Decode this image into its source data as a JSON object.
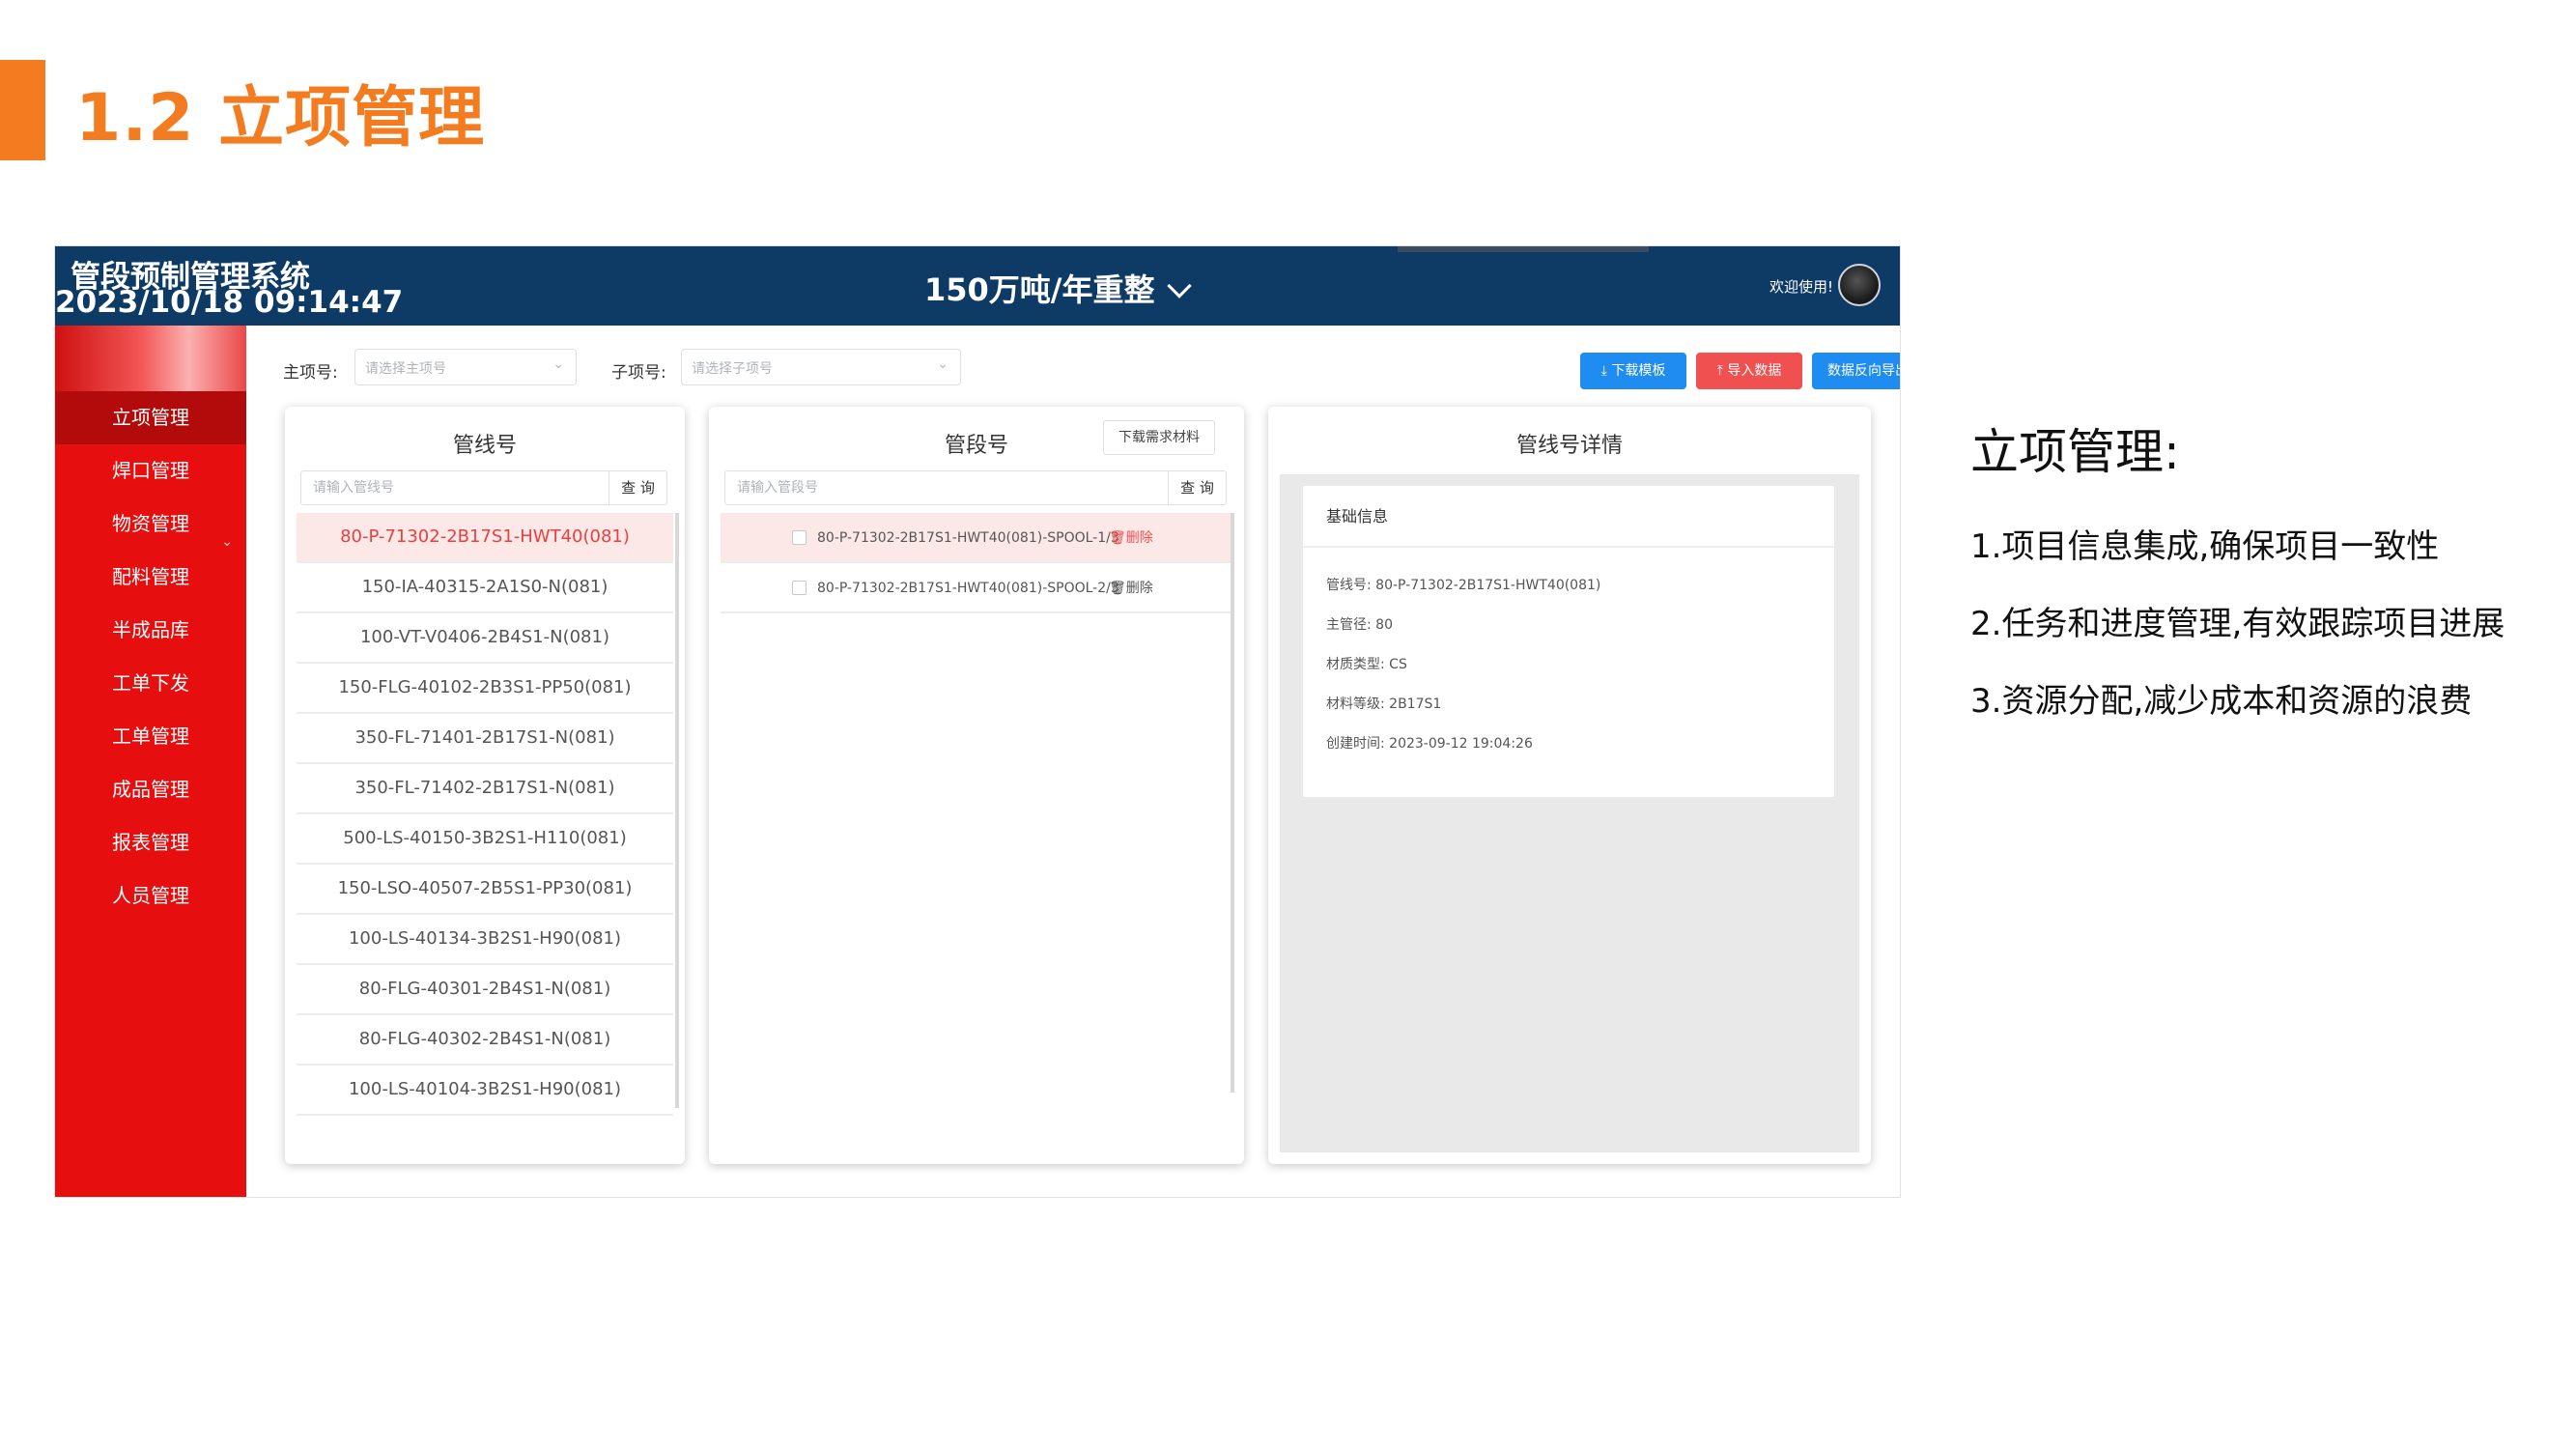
{
  "slide": {
    "title": "1.2 立项管理",
    "notes_heading": "立项管理:",
    "notes": [
      "1.项目信息集成,确保项目一致性",
      "2.任务和进度管理,有效跟踪项目进展",
      "3.资源分配,减少成本和资源的浪费"
    ]
  },
  "app": {
    "system_name": "管段预制管理系统",
    "datetime": "2023/10/18 09:14:47",
    "project_selector": "150万吨/年重整",
    "welcome": "欢迎使用!",
    "sidebar": [
      {
        "label": "立项管理",
        "active": true
      },
      {
        "label": "焊口管理"
      },
      {
        "label": "物资管理",
        "has_arrow": true
      },
      {
        "label": "配料管理"
      },
      {
        "label": "半成品库"
      },
      {
        "label": "工单下发"
      },
      {
        "label": "工单管理"
      },
      {
        "label": "成品管理"
      },
      {
        "label": "报表管理"
      },
      {
        "label": "人员管理"
      }
    ],
    "filters": {
      "main_label": "主项号:",
      "main_placeholder": "请选择主项号",
      "sub_label": "子项号:",
      "sub_placeholder": "请选择子项号"
    },
    "actions": {
      "download_template": "下载模板",
      "import_data": "导入数据",
      "reverse_export": "数据反向导出"
    },
    "line_panel": {
      "title": "管线号",
      "search_placeholder": "请输入管线号",
      "search_button": "查 询",
      "items": [
        "80-P-71302-2B17S1-HWT40(081)",
        "150-IA-40315-2A1S0-N(081)",
        "100-VT-V0406-2B4S1-N(081)",
        "150-FLG-40102-2B3S1-PP50(081)",
        "350-FL-71401-2B17S1-N(081)",
        "350-FL-71402-2B17S1-N(081)",
        "500-LS-40150-3B2S1-H110(081)",
        "150-LSO-40507-2B5S1-PP30(081)",
        "100-LS-40134-3B2S1-H90(081)",
        "80-FLG-40301-2B4S1-N(081)",
        "80-FLG-40302-2B4S1-N(081)",
        "100-LS-40104-3B2S1-H90(081)"
      ],
      "selected_index": 0
    },
    "spool_panel": {
      "title": "管段号",
      "download_button": "下载需求材料",
      "search_placeholder": "请输入管段号",
      "search_button": "查 询",
      "delete_label": "删除",
      "items": [
        "80-P-71302-2B17S1-HWT40(081)-SPOOL-1/3",
        "80-P-71302-2B17S1-HWT40(081)-SPOOL-2/3"
      ],
      "selected_index": 0
    },
    "detail_panel": {
      "title": "管线号详情",
      "section": "基础信息",
      "fields": [
        {
          "label": "管线号:",
          "value": "80-P-71302-2B17S1-HWT40(081)"
        },
        {
          "label": "主管径:",
          "value": "80"
        },
        {
          "label": "材质类型:",
          "value": "CS"
        },
        {
          "label": "材料等级:",
          "value": "2B17S1"
        },
        {
          "label": "创建时间:",
          "value": "2023-09-12 19:04:26"
        }
      ]
    }
  },
  "colors": {
    "accent_orange": "#f47c20",
    "topbar_navy": "#0e3a66",
    "sidebar_red": "#e60e0e",
    "button_blue": "#1e8cf0",
    "button_red": "#f05050"
  }
}
